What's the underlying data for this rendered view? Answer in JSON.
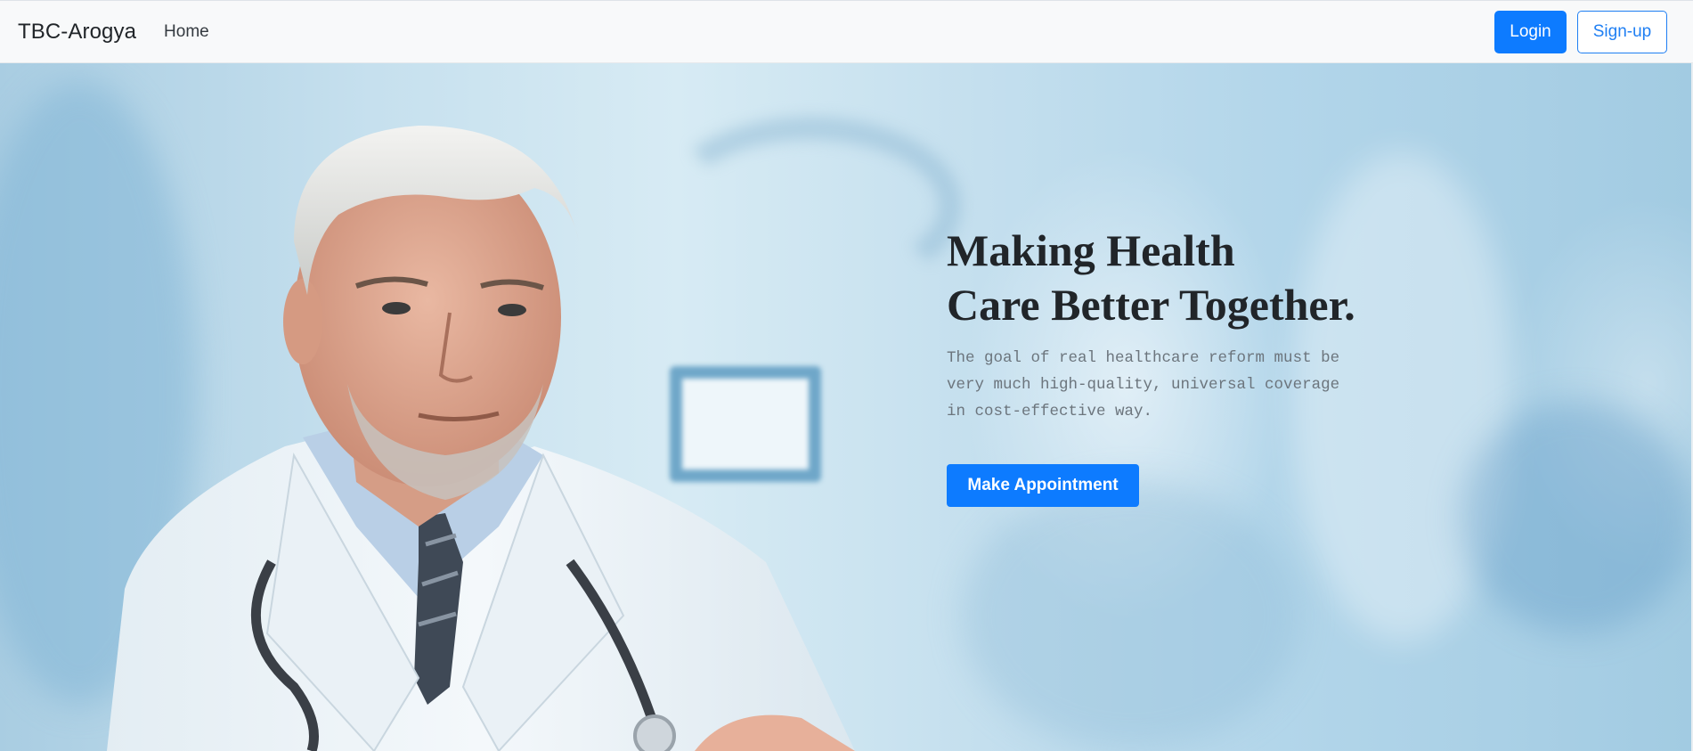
{
  "navbar": {
    "brand": "TBC-Arogya",
    "links": [
      {
        "label": "Home"
      }
    ],
    "login_label": "Login",
    "signup_label": "Sign-up"
  },
  "hero": {
    "title_line1": "Making Health",
    "title_line2": "Care Better Together.",
    "description": "The goal of real healthcare reform must be very much high-quality, universal coverage in cost-effective way.",
    "cta_label": "Make Appointment"
  },
  "colors": {
    "primary": "#0d7bff",
    "navbar_bg": "#f8f9fa",
    "title_text": "#212529",
    "muted_text": "#6c757d"
  }
}
